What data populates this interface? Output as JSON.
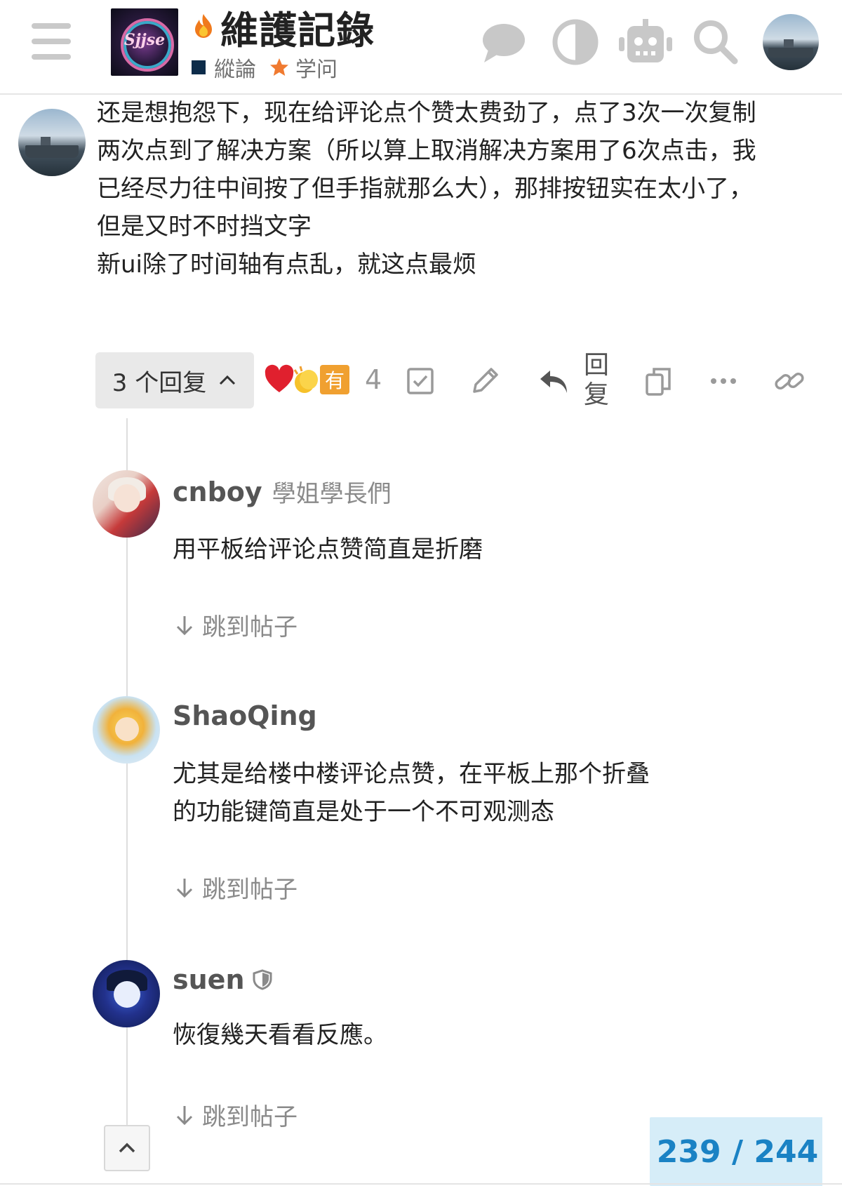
{
  "header": {
    "title": "維護記錄",
    "categories": [
      "縱論",
      "学问"
    ],
    "logo_text": "Sjjse",
    "icons": [
      "menu-icon",
      "chat-icon",
      "theme-toggle-icon",
      "robot-icon",
      "search-icon",
      "user-avatar"
    ]
  },
  "post": {
    "body_lines": [
      "还是想抱怨下，现在给评论点个赞太费劲了，点了3次一次复制",
      "两次点到了解决方案（所以算上取消解决方案用了6次点击，我",
      "已经尽力往中间按了但手指就那么大），那排按钮实在太小了，",
      "但是又时不时挡文字",
      "新ui除了时间轴有点乱，就这点最烦"
    ],
    "replies_button": "3 个回复",
    "reactions": {
      "you_badge": "有",
      "count": "4",
      "icons": [
        "heart-icon",
        "clap-icon"
      ]
    },
    "reply_label": "回复",
    "action_icons": [
      "solution-checkbox-icon",
      "edit-icon",
      "reply-icon",
      "copy-icon",
      "more-icon",
      "link-icon"
    ]
  },
  "replies": [
    {
      "username": "cnboy",
      "user_title": "學姐學長們",
      "text": [
        "用平板给评论点赞简直是折磨"
      ],
      "jump": "跳到帖子"
    },
    {
      "username": "ShaoQing",
      "user_title": "",
      "text": [
        "尤其是给楼中楼评论点赞，在平板上那个折叠",
        "的功能键简直是处于一个不可观测态"
      ],
      "jump": "跳到帖子"
    },
    {
      "username": "suen",
      "user_title": "",
      "text": [
        "恢復幾天看看反應。"
      ],
      "jump": "跳到帖子"
    }
  ],
  "footer": {
    "progress": "239 / 244"
  },
  "colors": {
    "accent": "#1a82c4",
    "progress_bg": "#d6edf8",
    "category_square": "#0d2c4a",
    "reaction_badge": "#f0a030"
  }
}
